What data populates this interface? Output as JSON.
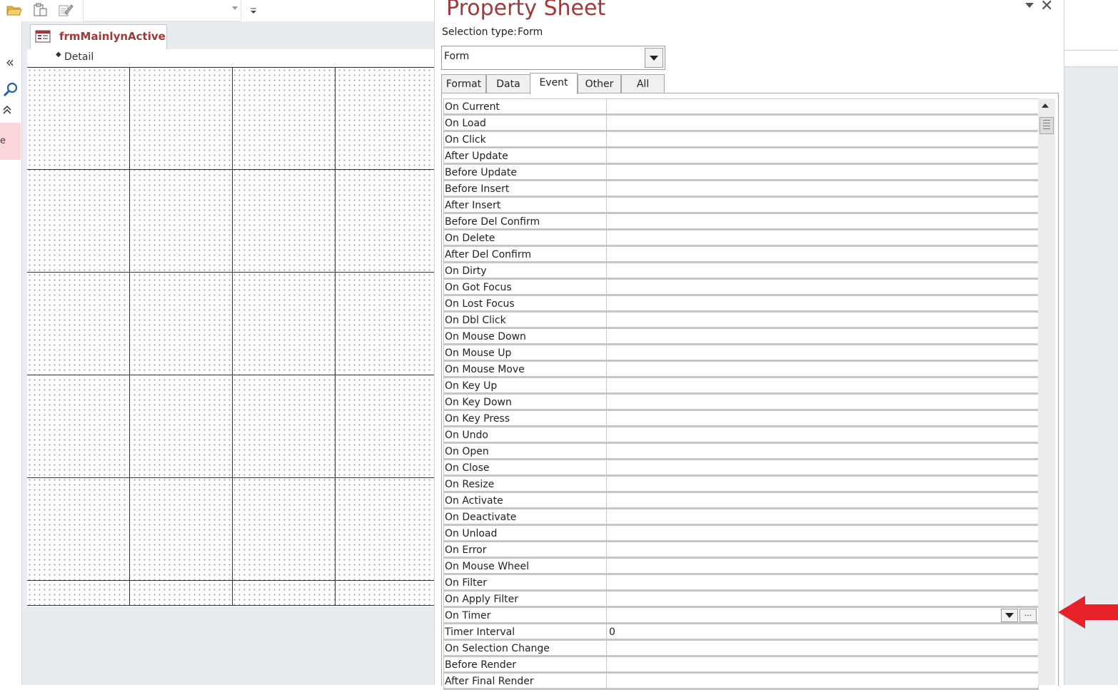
{
  "document_tab": {
    "label": "frmMainlynActive"
  },
  "design": {
    "section_label": "Detail"
  },
  "nav_pane": {
    "collapse_glyph": "«",
    "shutter_glyph": "⌃",
    "pink_item_text": "e"
  },
  "property_sheet": {
    "title": "Property Sheet",
    "selection_type_label": "Selection type:",
    "selection_type_value": "Form",
    "object_combo_value": "Form",
    "close_glyph": "✕",
    "tabs": [
      {
        "label": "Format"
      },
      {
        "label": "Data"
      },
      {
        "label": "Event",
        "active": true
      },
      {
        "label": "Other"
      },
      {
        "label": "All"
      }
    ],
    "properties": [
      {
        "name": "On Current",
        "value": ""
      },
      {
        "name": "On Load",
        "value": ""
      },
      {
        "name": "On Click",
        "value": ""
      },
      {
        "name": "After Update",
        "value": ""
      },
      {
        "name": "Before Update",
        "value": ""
      },
      {
        "name": "Before Insert",
        "value": ""
      },
      {
        "name": "After Insert",
        "value": ""
      },
      {
        "name": "Before Del Confirm",
        "value": ""
      },
      {
        "name": "On Delete",
        "value": ""
      },
      {
        "name": "After Del Confirm",
        "value": ""
      },
      {
        "name": "On Dirty",
        "value": ""
      },
      {
        "name": "On Got Focus",
        "value": ""
      },
      {
        "name": "On Lost Focus",
        "value": ""
      },
      {
        "name": "On Dbl Click",
        "value": ""
      },
      {
        "name": "On Mouse Down",
        "value": ""
      },
      {
        "name": "On Mouse Up",
        "value": ""
      },
      {
        "name": "On Mouse Move",
        "value": ""
      },
      {
        "name": "On Key Up",
        "value": ""
      },
      {
        "name": "On Key Down",
        "value": ""
      },
      {
        "name": "On Key Press",
        "value": ""
      },
      {
        "name": "On Undo",
        "value": ""
      },
      {
        "name": "On Open",
        "value": ""
      },
      {
        "name": "On Close",
        "value": ""
      },
      {
        "name": "On Resize",
        "value": ""
      },
      {
        "name": "On Activate",
        "value": ""
      },
      {
        "name": "On Deactivate",
        "value": ""
      },
      {
        "name": "On Unload",
        "value": ""
      },
      {
        "name": "On Error",
        "value": ""
      },
      {
        "name": "On Mouse Wheel",
        "value": ""
      },
      {
        "name": "On Filter",
        "value": ""
      },
      {
        "name": "On Apply Filter",
        "value": ""
      },
      {
        "name": "On Timer",
        "value": "",
        "selected": true,
        "build_label": "..."
      },
      {
        "name": "Timer Interval",
        "value": "0"
      },
      {
        "name": "On Selection Change",
        "value": ""
      },
      {
        "name": "Before Render",
        "value": ""
      },
      {
        "name": "After Final Render",
        "value": ""
      }
    ]
  },
  "colors": {
    "accent": "#a4373a",
    "arrow": "#e8202a",
    "nav_pink": "#fbd5d9"
  }
}
